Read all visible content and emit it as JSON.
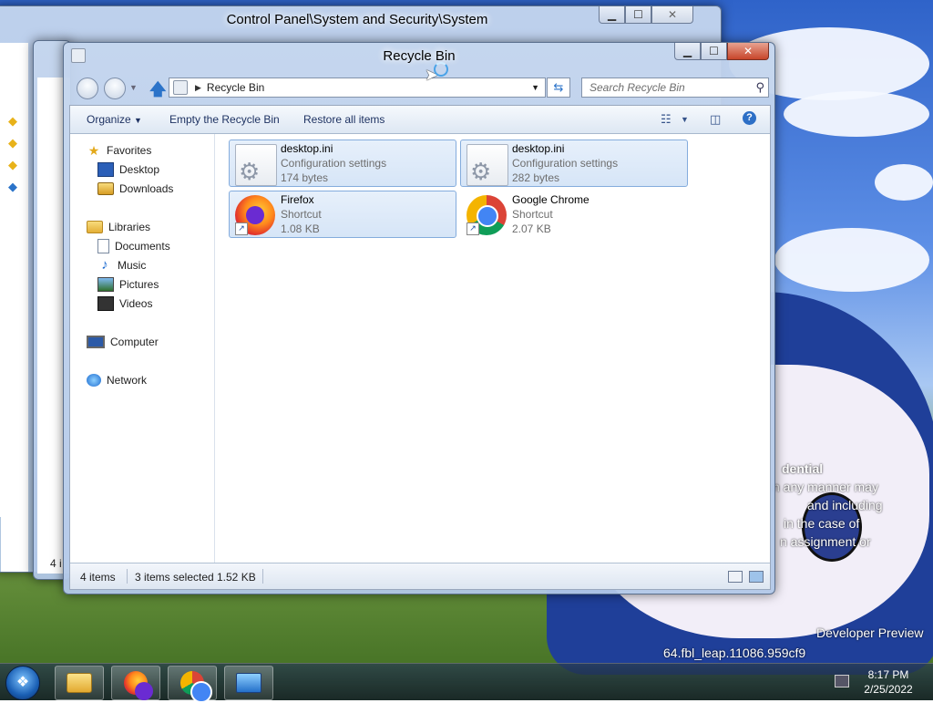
{
  "back_window": {
    "title": "Control Panel\\System and Security\\System",
    "status_fragment": "4 i"
  },
  "explorer": {
    "title": "Recycle Bin",
    "address": {
      "crumb": "Recycle Bin"
    },
    "search": {
      "placeholder": "Search Recycle Bin"
    },
    "toolbar": {
      "organize": "Organize",
      "empty": "Empty the Recycle Bin",
      "restore": "Restore all items"
    },
    "nav": {
      "favorites": "Favorites",
      "desktop": "Desktop",
      "downloads": "Downloads",
      "libraries": "Libraries",
      "documents": "Documents",
      "music": "Music",
      "pictures": "Pictures",
      "videos": "Videos",
      "computer": "Computer",
      "network": "Network"
    },
    "files": [
      {
        "name": "desktop.ini",
        "kind": "Configuration settings",
        "size": "174 bytes",
        "icon": "settings-file-icon",
        "selected": true
      },
      {
        "name": "desktop.ini",
        "kind": "Configuration settings",
        "size": "282 bytes",
        "icon": "settings-file-icon",
        "selected": true
      },
      {
        "name": "Firefox",
        "kind": "Shortcut",
        "size": "1.08 KB",
        "icon": "firefox-icon",
        "selected": true
      },
      {
        "name": "Google Chrome",
        "kind": "Shortcut",
        "size": "2.07 KB",
        "icon": "chrome-icon",
        "selected": false
      }
    ],
    "status": {
      "count": "4 items",
      "selected": "3 items selected",
      "size": "1.52 KB"
    }
  },
  "desktop_watermark": {
    "line1": "dential",
    "line2": "n any manner may",
    "line3": "and including",
    "line4": "in the case of",
    "line5": "n assignment or",
    "line6": "Developer Preview",
    "line7": "64.fbl_leap.11086.959cf9"
  },
  "taskbar": {
    "time": "8:17 PM",
    "date": "2/25/2022"
  },
  "colors": {
    "selection": "#d6e5f7",
    "selection_border": "#84acdd",
    "toolbar_text": "#1e3262",
    "taskbar": "#1e2d3c"
  }
}
